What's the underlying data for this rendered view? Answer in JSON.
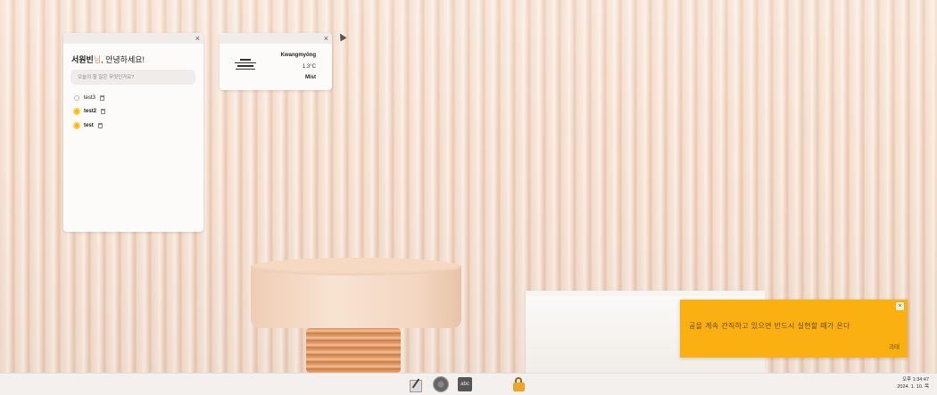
{
  "todo_widget": {
    "close_label": "×",
    "greeting_name": "서원빈",
    "greeting_honorific": "님",
    "greeting_rest": ", 안녕하세요!",
    "input_placeholder": "오늘의 할 일은 무엇인가요?",
    "tasks": [
      {
        "label": "test3",
        "done": false
      },
      {
        "label": "test2",
        "done": true
      },
      {
        "label": "test",
        "done": true
      }
    ]
  },
  "weather_widget": {
    "close_label": "×",
    "icon": "mist-icon",
    "city": "Kwangmyŏng",
    "temperature": "1.3°C",
    "condition": "Mist"
  },
  "notification": {
    "close_label": "×",
    "quote": "공을 계속 간직하고 있으면 반드시 실현할 때가 온다",
    "author": "괴테",
    "color": "#fbb012"
  },
  "taskbar": {
    "icons": [
      "pen-paper-icon",
      "gear-icon",
      "abc-icon",
      "lock-icon"
    ],
    "abc_label": "abc",
    "clock_time": "오후 1:34:47",
    "clock_date": "2024. 1. 10. 목"
  }
}
